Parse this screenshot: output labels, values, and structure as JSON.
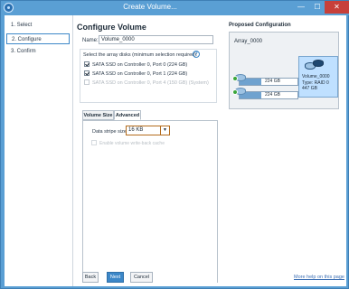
{
  "window": {
    "title": "Create Volume...",
    "minimize_glyph": "—",
    "maximize_glyph": "☐",
    "close_glyph": "✕"
  },
  "steps": [
    {
      "label": "1. Select",
      "active": false
    },
    {
      "label": "2. Configure",
      "active": true
    },
    {
      "label": "3. Confirm",
      "active": false
    }
  ],
  "configure": {
    "heading": "Configure Volume",
    "name_label": "Name:",
    "name_value": "Volume_0000",
    "disks_header": "Select the array disks (minimum selection required):",
    "help_glyph": "?",
    "disks": [
      {
        "label": "SATA SSD on Controller 0, Port 0 (224 GB)",
        "checked": true,
        "enabled": true
      },
      {
        "label": "SATA SSD on Controller 0, Port 1 (224 GB)",
        "checked": true,
        "enabled": true
      },
      {
        "label": "SATA SSD on Controller 0, Port 4 (150 GB) (System)",
        "checked": false,
        "enabled": false
      }
    ]
  },
  "tabs": {
    "volume_size": "Volume Size",
    "advanced": "Advanced"
  },
  "advanced": {
    "stripe_label": "Data stripe size:",
    "stripe_value": "16 KB",
    "stripe_arrow": "▼",
    "cache_label": "Enable volume write-back cache"
  },
  "proposed": {
    "title": "Proposed Configuration",
    "array_label": "Array_0000",
    "disk1": "224 GB",
    "disk2": "224 GB",
    "volume_name": "Volume_0000",
    "volume_type": "Type: RAID 0",
    "volume_size": "447 GB"
  },
  "footer": {
    "back": "Back",
    "next": "Next",
    "cancel": "Cancel",
    "help_link": "More help on this page"
  },
  "colors": {
    "accent": "#3c87c8",
    "title_bar": "#5a9fd4",
    "close": "#c7403a",
    "volume_card": "#bfe0ff",
    "check_badge": "#3aa63a"
  }
}
